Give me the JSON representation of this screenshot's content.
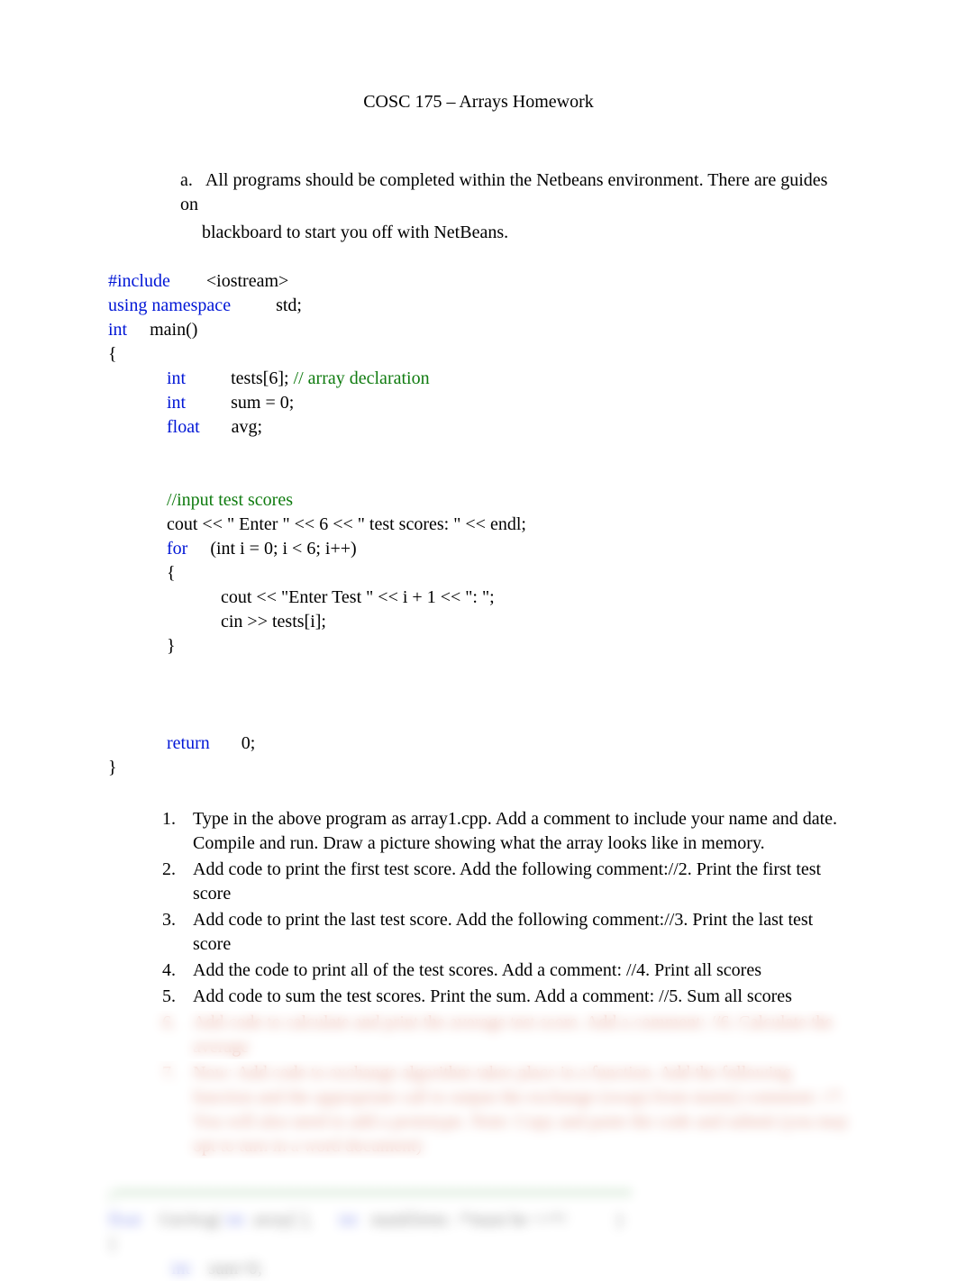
{
  "title": "COSC 175 – Arrays Homework",
  "alpha": {
    "marker": "a.",
    "line1": "All programs should be completed within the Netbeans environment. There are guides on",
    "line2": "blackboard to start you off with NetBeans."
  },
  "code": {
    "l1a": "#include",
    "l1b": "        <iostream>",
    "l2a": "using namespace",
    "l2b": "          std;",
    "l3a": "int",
    "l3b": "     main()",
    "l4": "{",
    "l5a": "             int",
    "l5b": "          tests[6]; ",
    "l5c": "// array declaration",
    "l6a": "             int",
    "l6b": "          sum = 0;",
    "l7a": "             float",
    "l7b": "       avg;",
    "l8": "",
    "l9": "",
    "l10a": "             ",
    "l10b": "//input test scores",
    "l11": "             cout << \" Enter \" << 6 << \" test scores: \" << endl;",
    "l12a": "             for",
    "l12b": "     (int i = 0; i < 6; i++)",
    "l13": "             {",
    "l14": "                         cout << \"Enter Test \" << i + 1 << \": \";",
    "l15": "                         cin >> tests[i];",
    "l16": "             }",
    "l17": "",
    "l18": "",
    "l19": "",
    "l20a": "             return",
    "l20b": "       0;",
    "l21": "}"
  },
  "items": {
    "n1": {
      "m": "1.",
      "t": "Type in the above program as array1.cpp. Add a comment to include your name and date. Compile and run. Draw a picture showing what the array looks like in memory."
    },
    "n2": {
      "m": "2.",
      "t": "Add code to print the first test score. Add the following comment://2. Print the first test score"
    },
    "n3": {
      "m": "3.",
      "t": "Add code to print the last test score. Add the following comment://3. Print the last test score"
    },
    "n4": {
      "m": "4.",
      "t": "Add the code to print all of the test scores. Add a comment: //4. Print all scores"
    },
    "n5": {
      "m": "5.",
      "t": "Add code to sum the test scores. Print the sum. Add a comment: //5. Sum all scores"
    },
    "n6": {
      "m": "6.",
      "t": "Add code to calculate and print the average test score.  Add a comment: //6. Calculate the average"
    },
    "n7": {
      "m": "7.",
      "t": "Now: Add code to exchange algorithm takes place in a function.  Add the following function and the appropriate call to output the exchange (swap) from main() comment: //7. You will also need to add a prototype. Note: Copy and paste the code and submit (you may opt to turn in a word document)"
    }
  },
  "bottom": {
    "comment": "//*********************************************************",
    "line_a_kw1": "float",
    "line_a_txt1": "    GetAvg( ",
    "line_a_kw2": "int",
    "line_a_txt2": "  array[ ],      ",
    "line_a_kw3": "int",
    "line_a_txt3": "   numElems  /*must be <=*/           )",
    "line_b": "{",
    "line_c_kw": "              int",
    "line_c_txt": "    sum=0;"
  }
}
